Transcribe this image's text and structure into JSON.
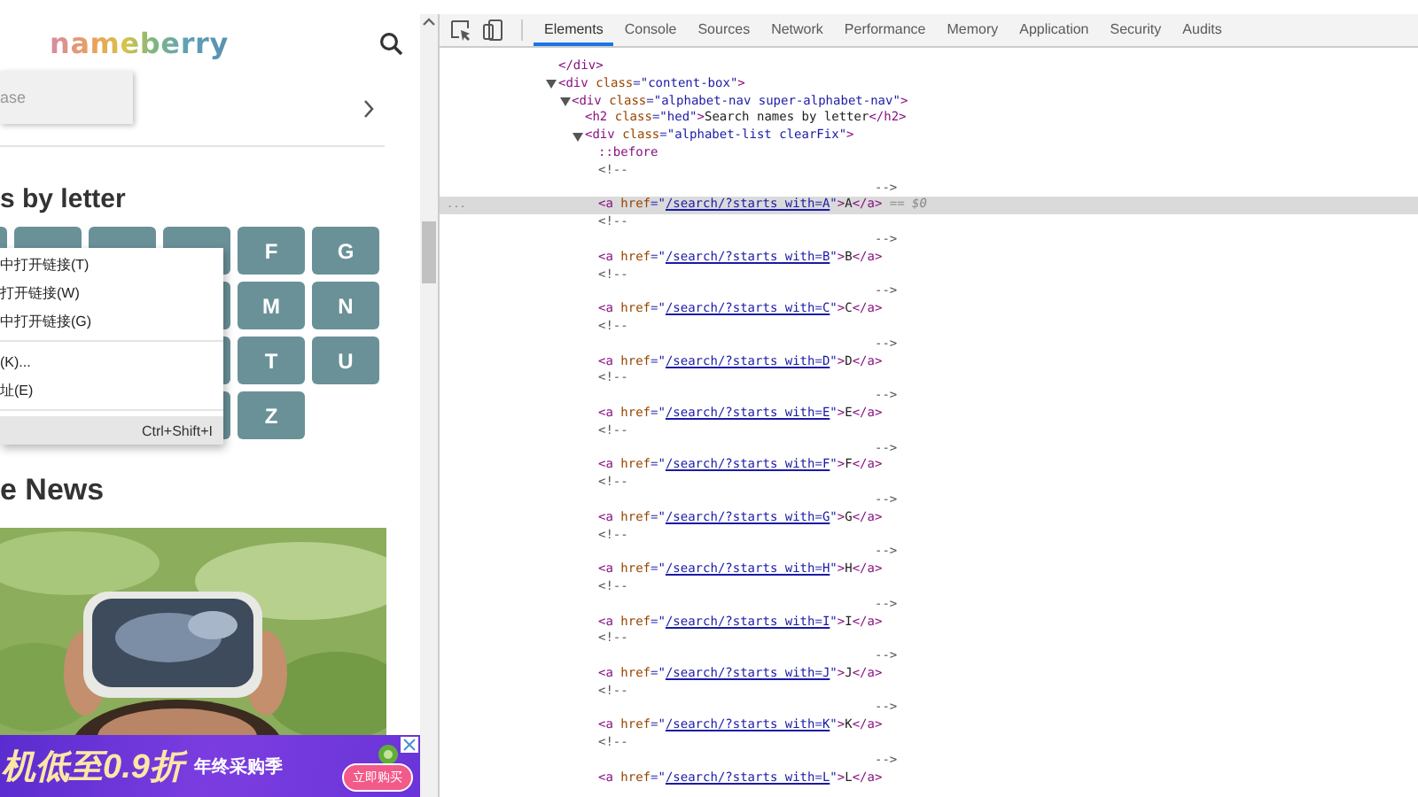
{
  "site": {
    "logo": "nameberry",
    "search_field": {
      "placeholder": "ase"
    },
    "section_title": "s by letter",
    "letter_rows": [
      [
        "F",
        "G"
      ],
      [
        "M",
        "N"
      ],
      [
        "T",
        "U"
      ],
      [
        "Z"
      ]
    ],
    "news_title": "e News",
    "picture": {
      "kind": "picture"
    }
  },
  "context_menu": {
    "items": [
      {
        "kind": "item",
        "label": "中打开链接(T)",
        "highlighted": false
      },
      {
        "kind": "item",
        "label": "打开链接(W)",
        "highlighted": false
      },
      {
        "kind": "item",
        "label": "中打开链接(G)",
        "highlighted": false
      },
      {
        "kind": "separator"
      },
      {
        "kind": "item",
        "label": "(K)...",
        "highlighted": false
      },
      {
        "kind": "item",
        "label": "址(E)",
        "highlighted": false
      },
      {
        "kind": "separator"
      },
      {
        "kind": "item",
        "shortcut": "Ctrl+Shift+I",
        "highlighted": true
      }
    ]
  },
  "ad": {
    "headline": "机低至0.9折",
    "tagline": "年终采购季",
    "button": "立即购买"
  },
  "devtools": {
    "tabs": [
      {
        "label": "Elements",
        "selected": true
      },
      {
        "label": "Console",
        "selected": false
      },
      {
        "label": "Sources",
        "selected": false
      },
      {
        "label": "Network",
        "selected": false
      },
      {
        "label": "Performance",
        "selected": false
      },
      {
        "label": "Memory",
        "selected": false
      },
      {
        "label": "Application",
        "selected": false
      },
      {
        "label": "Security",
        "selected": false
      },
      {
        "label": "Audits",
        "selected": false
      }
    ],
    "lines": [
      {
        "kind": "node",
        "selected": false,
        "parts": [
          {
            "t": "</div>",
            "kind": "tag"
          }
        ]
      },
      {
        "kind": "node",
        "selected": false,
        "expanded": true,
        "parts": [
          {
            "t": "<div",
            "kind": "tag"
          },
          {
            "t": " class",
            "kind": "attr"
          },
          {
            "t": "=\"",
            "kind": "value"
          },
          {
            "t": "content-box",
            "kind": "value"
          },
          {
            "t": "\"",
            "kind": "value"
          },
          {
            "t": ">",
            "kind": "tag"
          }
        ],
        "children": [
          {
            "kind": "node",
            "selected": false,
            "expanded": true,
            "parts": [
              {
                "t": "<div",
                "kind": "tag"
              },
              {
                "t": " class",
                "kind": "attr"
              },
              {
                "t": "=\"",
                "kind": "value"
              },
              {
                "t": "alphabet-nav super-alphabet-nav",
                "kind": "value"
              },
              {
                "t": "\"",
                "kind": "value"
              },
              {
                "t": ">",
                "kind": "tag"
              }
            ],
            "children": [
              {
                "kind": "node",
                "selected": false,
                "parts": [
                  {
                    "t": "<h2",
                    "kind": "tag"
                  },
                  {
                    "t": " class",
                    "kind": "attr"
                  },
                  {
                    "t": "=\"",
                    "kind": "value"
                  },
                  {
                    "t": "hed",
                    "kind": "value"
                  },
                  {
                    "t": "\"",
                    "kind": "value"
                  },
                  {
                    "t": ">",
                    "kind": "tag"
                  },
                  {
                    "t": "Search names by letter",
                    "kind": "text"
                  },
                  {
                    "t": "</h2>",
                    "kind": "tag"
                  }
                ]
              },
              {
                "kind": "node",
                "selected": false,
                "expanded": true,
                "parts": [
                  {
                    "t": "<div",
                    "kind": "tag"
                  },
                  {
                    "t": " class",
                    "kind": "attr"
                  },
                  {
                    "t": "=\"",
                    "kind": "value"
                  },
                  {
                    "t": "alphabet-list clearFix",
                    "kind": "value"
                  },
                  {
                    "t": "\"",
                    "kind": "value"
                  },
                  {
                    "t": ">",
                    "kind": "tag"
                  }
                ],
                "children": [
                  {
                    "kind": "node",
                    "selected": false,
                    "parts": [
                      {
                        "t": "::before",
                        "kind": "pseudo"
                      }
                    ]
                  },
                  {
                    "kind": "node",
                    "selected": false,
                    "parts": [
                      {
                        "t": "<!--",
                        "kind": "comment"
                      }
                    ]
                  },
                  {
                    "kind": "comment_end",
                    "selected": false,
                    "parts": [
                      {
                        "t": "-->",
                        "kind": "comment"
                      }
                    ]
                  },
                  {
                    "kind": "node",
                    "selected": true,
                    "gutter": "...",
                    "parts": [
                      {
                        "t": "<a",
                        "kind": "tag"
                      },
                      {
                        "t": " href",
                        "kind": "attr"
                      },
                      {
                        "t": "=\"",
                        "kind": "value"
                      },
                      {
                        "t": "/search/?starts_with=A",
                        "kind": "link"
                      },
                      {
                        "t": "\"",
                        "kind": "value"
                      },
                      {
                        "t": ">",
                        "kind": "tag"
                      },
                      {
                        "t": "A",
                        "kind": "text"
                      },
                      {
                        "t": "</a>",
                        "kind": "tag"
                      },
                      {
                        "t": " == $0",
                        "kind": "marker"
                      }
                    ]
                  },
                  {
                    "kind": "node",
                    "selected": false,
                    "parts": [
                      {
                        "t": "<!--",
                        "kind": "comment"
                      }
                    ]
                  },
                  {
                    "kind": "comment_end",
                    "selected": false,
                    "parts": [
                      {
                        "t": "-->",
                        "kind": "comment"
                      }
                    ]
                  },
                  {
                    "kind": "node",
                    "selected": false,
                    "parts": [
                      {
                        "t": "<a",
                        "kind": "tag"
                      },
                      {
                        "t": " href",
                        "kind": "attr"
                      },
                      {
                        "t": "=\"",
                        "kind": "value"
                      },
                      {
                        "t": "/search/?starts_with=B",
                        "kind": "link"
                      },
                      {
                        "t": "\"",
                        "kind": "value"
                      },
                      {
                        "t": ">",
                        "kind": "tag"
                      },
                      {
                        "t": "B",
                        "kind": "text"
                      },
                      {
                        "t": "</a>",
                        "kind": "tag"
                      }
                    ]
                  },
                  {
                    "kind": "node",
                    "selected": false,
                    "parts": [
                      {
                        "t": "<!--",
                        "kind": "comment"
                      }
                    ]
                  },
                  {
                    "kind": "comment_end",
                    "selected": false,
                    "parts": [
                      {
                        "t": "-->",
                        "kind": "comment"
                      }
                    ]
                  },
                  {
                    "kind": "node",
                    "selected": false,
                    "parts": [
                      {
                        "t": "<a",
                        "kind": "tag"
                      },
                      {
                        "t": " href",
                        "kind": "attr"
                      },
                      {
                        "t": "=\"",
                        "kind": "value"
                      },
                      {
                        "t": "/search/?starts_with=C",
                        "kind": "link"
                      },
                      {
                        "t": "\"",
                        "kind": "value"
                      },
                      {
                        "t": ">",
                        "kind": "tag"
                      },
                      {
                        "t": "C",
                        "kind": "text"
                      },
                      {
                        "t": "</a>",
                        "kind": "tag"
                      }
                    ]
                  },
                  {
                    "kind": "node",
                    "selected": false,
                    "parts": [
                      {
                        "t": "<!--",
                        "kind": "comment"
                      }
                    ]
                  },
                  {
                    "kind": "comment_end",
                    "selected": false,
                    "parts": [
                      {
                        "t": "-->",
                        "kind": "comment"
                      }
                    ]
                  },
                  {
                    "kind": "node",
                    "selected": false,
                    "parts": [
                      {
                        "t": "<a",
                        "kind": "tag"
                      },
                      {
                        "t": " href",
                        "kind": "attr"
                      },
                      {
                        "t": "=\"",
                        "kind": "value"
                      },
                      {
                        "t": "/search/?starts_with=D",
                        "kind": "link"
                      },
                      {
                        "t": "\"",
                        "kind": "value"
                      },
                      {
                        "t": ">",
                        "kind": "tag"
                      },
                      {
                        "t": "D",
                        "kind": "text"
                      },
                      {
                        "t": "</a>",
                        "kind": "tag"
                      }
                    ]
                  },
                  {
                    "kind": "node",
                    "selected": false,
                    "parts": [
                      {
                        "t": "<!--",
                        "kind": "comment"
                      }
                    ]
                  },
                  {
                    "kind": "comment_end",
                    "selected": false,
                    "parts": [
                      {
                        "t": "-->",
                        "kind": "comment"
                      }
                    ]
                  },
                  {
                    "kind": "node",
                    "selected": false,
                    "parts": [
                      {
                        "t": "<a",
                        "kind": "tag"
                      },
                      {
                        "t": " href",
                        "kind": "attr"
                      },
                      {
                        "t": "=\"",
                        "kind": "value"
                      },
                      {
                        "t": "/search/?starts_with=E",
                        "kind": "link"
                      },
                      {
                        "t": "\"",
                        "kind": "value"
                      },
                      {
                        "t": ">",
                        "kind": "tag"
                      },
                      {
                        "t": "E",
                        "kind": "text"
                      },
                      {
                        "t": "</a>",
                        "kind": "tag"
                      }
                    ]
                  },
                  {
                    "kind": "node",
                    "selected": false,
                    "parts": [
                      {
                        "t": "<!--",
                        "kind": "comment"
                      }
                    ]
                  },
                  {
                    "kind": "comment_end",
                    "selected": false,
                    "parts": [
                      {
                        "t": "-->",
                        "kind": "comment"
                      }
                    ]
                  },
                  {
                    "kind": "node",
                    "selected": false,
                    "parts": [
                      {
                        "t": "<a",
                        "kind": "tag"
                      },
                      {
                        "t": " href",
                        "kind": "attr"
                      },
                      {
                        "t": "=\"",
                        "kind": "value"
                      },
                      {
                        "t": "/search/?starts_with=F",
                        "kind": "link"
                      },
                      {
                        "t": "\"",
                        "kind": "value"
                      },
                      {
                        "t": ">",
                        "kind": "tag"
                      },
                      {
                        "t": "F",
                        "kind": "text"
                      },
                      {
                        "t": "</a>",
                        "kind": "tag"
                      }
                    ]
                  },
                  {
                    "kind": "node",
                    "selected": false,
                    "parts": [
                      {
                        "t": "<!--",
                        "kind": "comment"
                      }
                    ]
                  },
                  {
                    "kind": "comment_end",
                    "selected": false,
                    "parts": [
                      {
                        "t": "-->",
                        "kind": "comment"
                      }
                    ]
                  },
                  {
                    "kind": "node",
                    "selected": false,
                    "parts": [
                      {
                        "t": "<a",
                        "kind": "tag"
                      },
                      {
                        "t": " href",
                        "kind": "attr"
                      },
                      {
                        "t": "=\"",
                        "kind": "value"
                      },
                      {
                        "t": "/search/?starts_with=G",
                        "kind": "link"
                      },
                      {
                        "t": "\"",
                        "kind": "value"
                      },
                      {
                        "t": ">",
                        "kind": "tag"
                      },
                      {
                        "t": "G",
                        "kind": "text"
                      },
                      {
                        "t": "</a>",
                        "kind": "tag"
                      }
                    ]
                  },
                  {
                    "kind": "node",
                    "selected": false,
                    "parts": [
                      {
                        "t": "<!--",
                        "kind": "comment"
                      }
                    ]
                  },
                  {
                    "kind": "comment_end",
                    "selected": false,
                    "parts": [
                      {
                        "t": "-->",
                        "kind": "comment"
                      }
                    ]
                  },
                  {
                    "kind": "node",
                    "selected": false,
                    "parts": [
                      {
                        "t": "<a",
                        "kind": "tag"
                      },
                      {
                        "t": " href",
                        "kind": "attr"
                      },
                      {
                        "t": "=\"",
                        "kind": "value"
                      },
                      {
                        "t": "/search/?starts_with=H",
                        "kind": "link"
                      },
                      {
                        "t": "\"",
                        "kind": "value"
                      },
                      {
                        "t": ">",
                        "kind": "tag"
                      },
                      {
                        "t": "H",
                        "kind": "text"
                      },
                      {
                        "t": "</a>",
                        "kind": "tag"
                      }
                    ]
                  },
                  {
                    "kind": "node",
                    "selected": false,
                    "parts": [
                      {
                        "t": "<!--",
                        "kind": "comment"
                      }
                    ]
                  },
                  {
                    "kind": "comment_end",
                    "selected": false,
                    "parts": [
                      {
                        "t": "-->",
                        "kind": "comment"
                      }
                    ]
                  },
                  {
                    "kind": "node",
                    "selected": false,
                    "parts": [
                      {
                        "t": "<a",
                        "kind": "tag"
                      },
                      {
                        "t": " href",
                        "kind": "attr"
                      },
                      {
                        "t": "=\"",
                        "kind": "value"
                      },
                      {
                        "t": "/search/?starts_with=I",
                        "kind": "link"
                      },
                      {
                        "t": "\"",
                        "kind": "value"
                      },
                      {
                        "t": ">",
                        "kind": "tag"
                      },
                      {
                        "t": "I",
                        "kind": "text"
                      },
                      {
                        "t": "</a>",
                        "kind": "tag"
                      }
                    ]
                  },
                  {
                    "kind": "node",
                    "selected": false,
                    "parts": [
                      {
                        "t": "<!--",
                        "kind": "comment"
                      }
                    ]
                  },
                  {
                    "kind": "comment_end",
                    "selected": false,
                    "parts": [
                      {
                        "t": "-->",
                        "kind": "comment"
                      }
                    ]
                  },
                  {
                    "kind": "node",
                    "selected": false,
                    "parts": [
                      {
                        "t": "<a",
                        "kind": "tag"
                      },
                      {
                        "t": " href",
                        "kind": "attr"
                      },
                      {
                        "t": "=\"",
                        "kind": "value"
                      },
                      {
                        "t": "/search/?starts_with=J",
                        "kind": "link"
                      },
                      {
                        "t": "\"",
                        "kind": "value"
                      },
                      {
                        "t": ">",
                        "kind": "tag"
                      },
                      {
                        "t": "J",
                        "kind": "text"
                      },
                      {
                        "t": "</a>",
                        "kind": "tag"
                      }
                    ]
                  },
                  {
                    "kind": "node",
                    "selected": false,
                    "parts": [
                      {
                        "t": "<!--",
                        "kind": "comment"
                      }
                    ]
                  },
                  {
                    "kind": "comment_end",
                    "selected": false,
                    "parts": [
                      {
                        "t": "-->",
                        "kind": "comment"
                      }
                    ]
                  },
                  {
                    "kind": "node",
                    "selected": false,
                    "parts": [
                      {
                        "t": "<a",
                        "kind": "tag"
                      },
                      {
                        "t": " href",
                        "kind": "attr"
                      },
                      {
                        "t": "=\"",
                        "kind": "value"
                      },
                      {
                        "t": "/search/?starts_with=K",
                        "kind": "link"
                      },
                      {
                        "t": "\"",
                        "kind": "value"
                      },
                      {
                        "t": ">",
                        "kind": "tag"
                      },
                      {
                        "t": "K",
                        "kind": "text"
                      },
                      {
                        "t": "</a>",
                        "kind": "tag"
                      }
                    ]
                  },
                  {
                    "kind": "node",
                    "selected": false,
                    "parts": [
                      {
                        "t": "<!--",
                        "kind": "comment"
                      }
                    ]
                  },
                  {
                    "kind": "comment_end",
                    "selected": false,
                    "parts": [
                      {
                        "t": "-->",
                        "kind": "comment"
                      }
                    ]
                  },
                  {
                    "kind": "node",
                    "selected": false,
                    "parts": [
                      {
                        "t": "<a",
                        "kind": "tag"
                      },
                      {
                        "t": " href",
                        "kind": "attr"
                      },
                      {
                        "t": "=\"",
                        "kind": "value"
                      },
                      {
                        "t": "/search/?starts_with=L",
                        "kind": "link"
                      },
                      {
                        "t": "\"",
                        "kind": "value"
                      },
                      {
                        "t": ">",
                        "kind": "tag"
                      },
                      {
                        "t": "L",
                        "kind": "text"
                      },
                      {
                        "t": "</a>",
                        "kind": "tag"
                      }
                    ]
                  }
                ]
              }
            ]
          }
        ]
      }
    ]
  }
}
